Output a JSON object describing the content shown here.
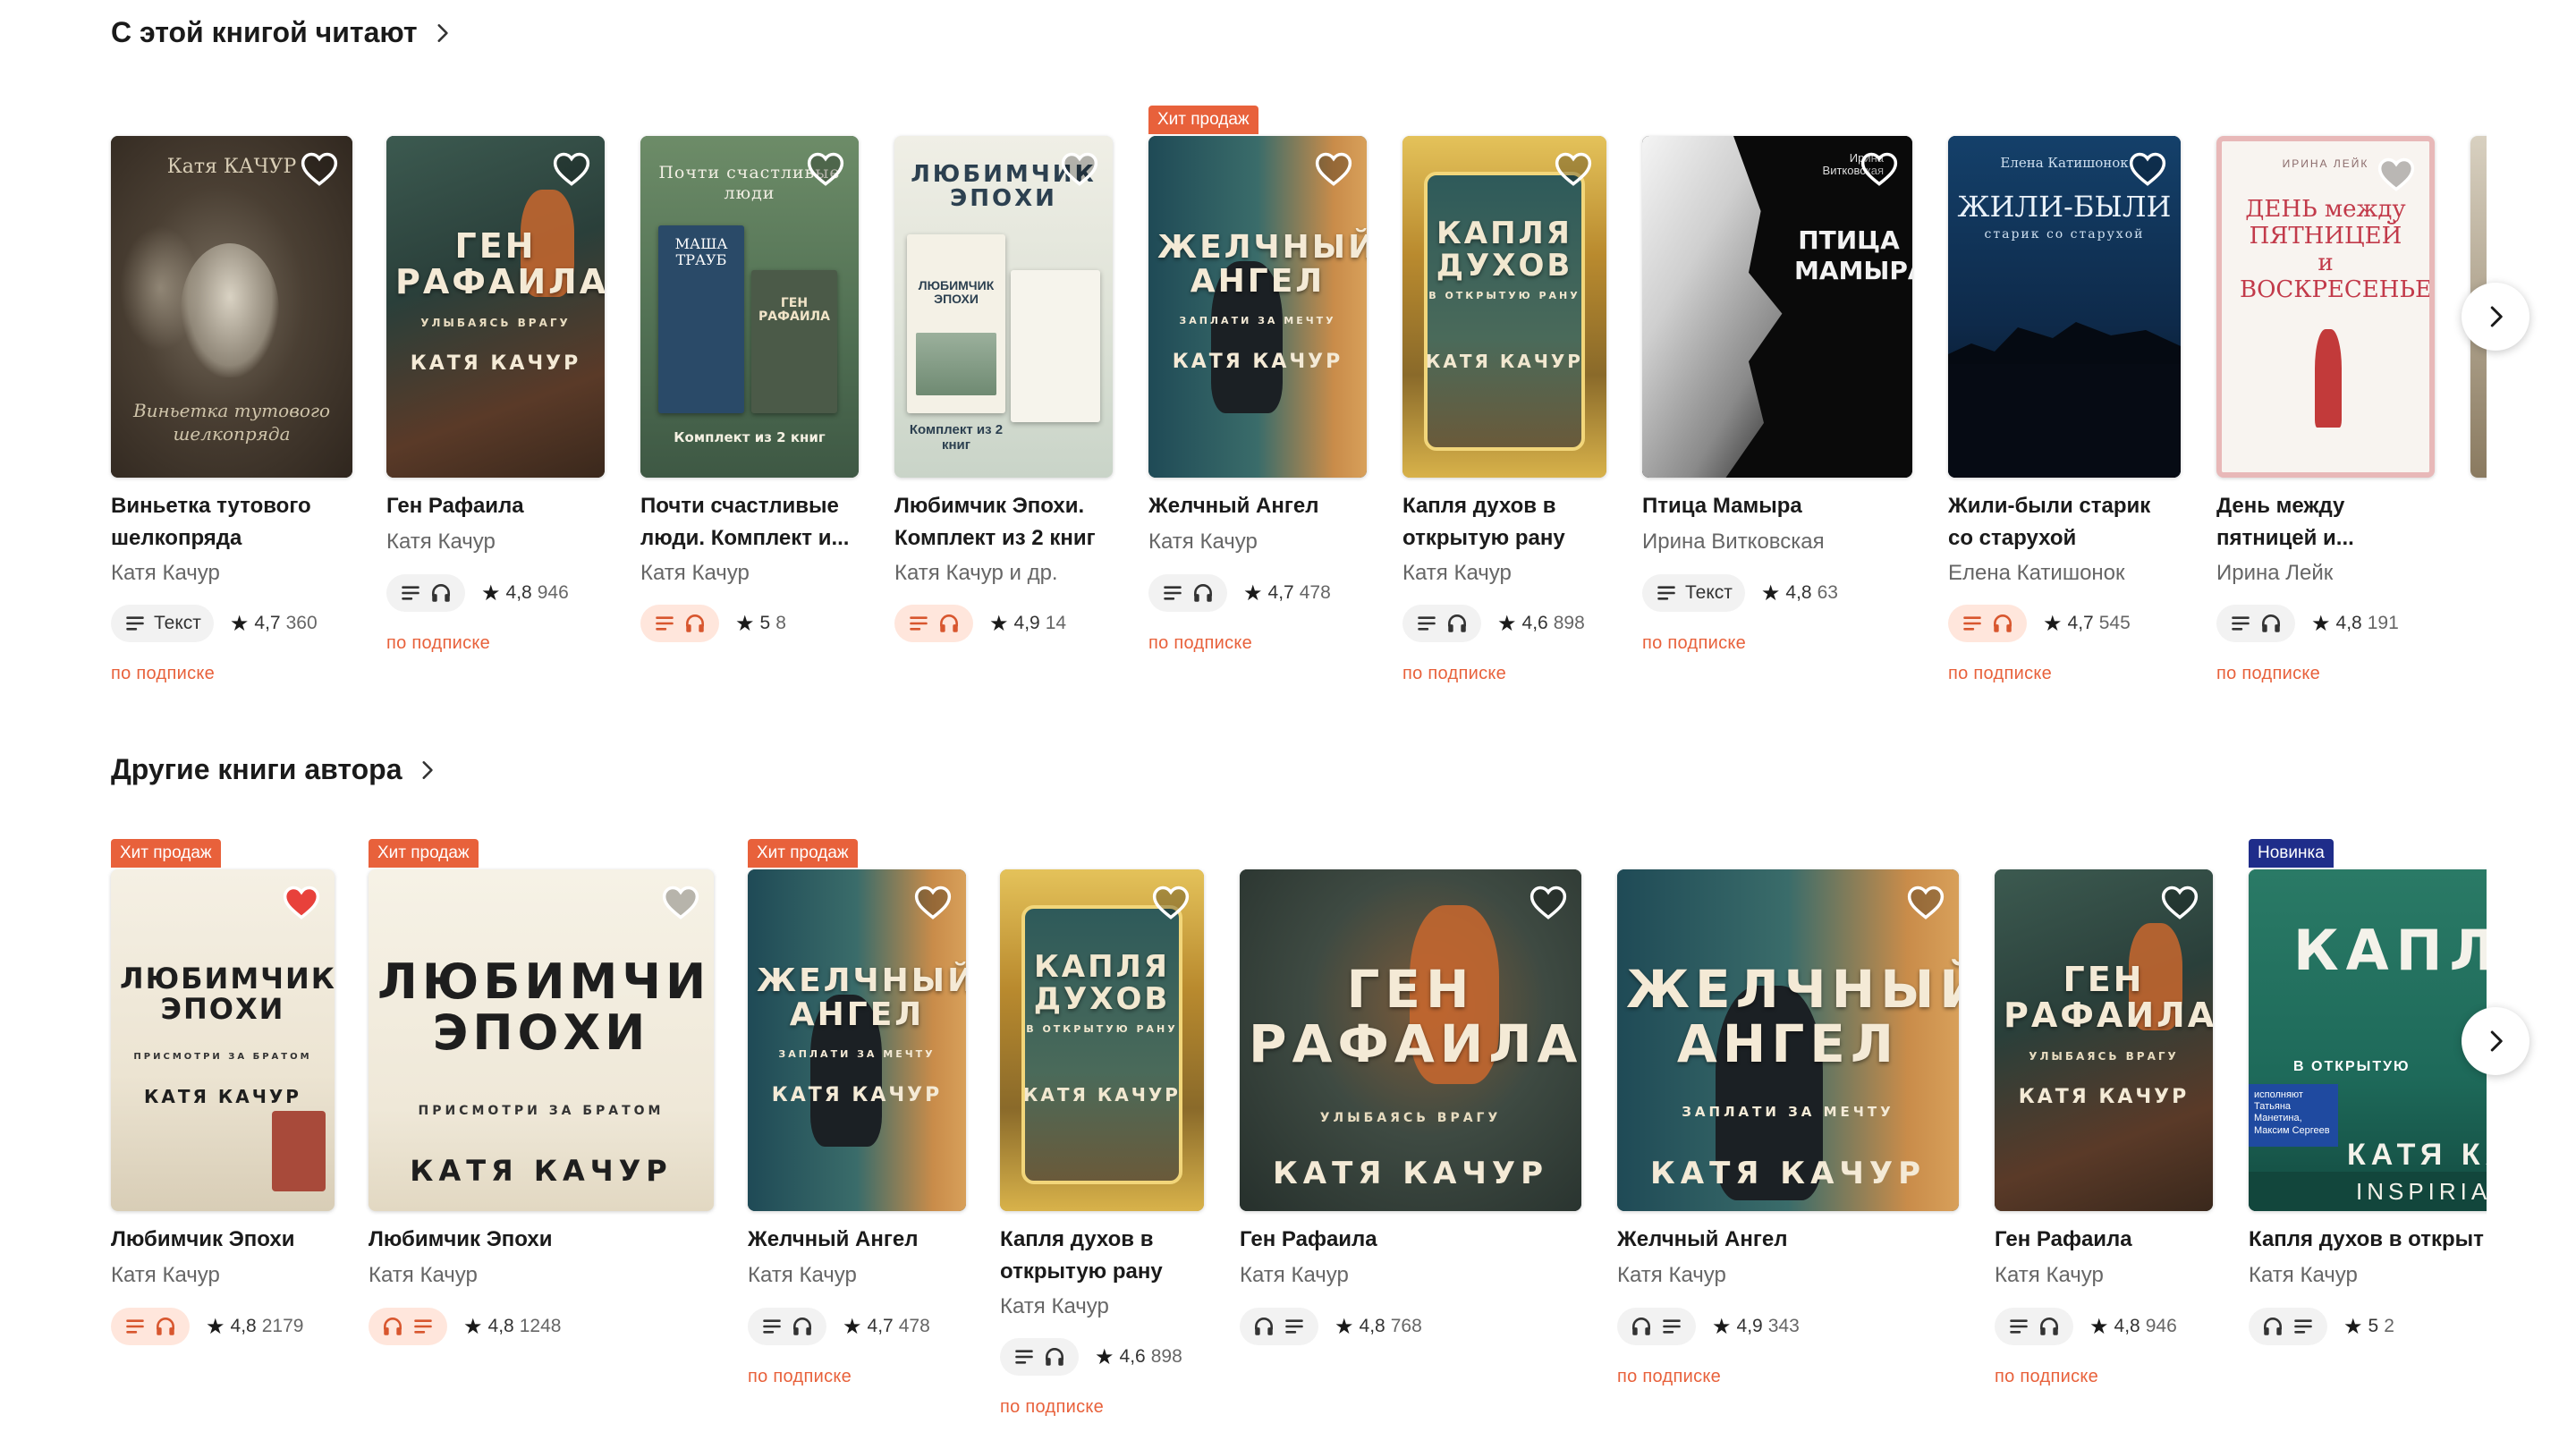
{
  "colors": {
    "accent": "#e8613b",
    "hit_badge": "#e8613b",
    "new_badge": "#1f2d8a"
  },
  "section1": {
    "title": "С этой книгой читают",
    "books": [
      {
        "title": "Виньетка тутового шелкопряда",
        "author": "Катя Качур",
        "format": "Текст",
        "rating": "4,7",
        "count": "360",
        "subscription": "по подписке",
        "cover_top": "Катя КАЧУР",
        "cover_bottom": "Виньетка тутового шелкопряда"
      },
      {
        "title": "Ген Рафаила",
        "author": "Катя Качур",
        "rating": "4,8",
        "count": "946",
        "subscription": "по подписке",
        "cover_main": "ГЕН РАФАИЛА",
        "cover_small": "УЛЫБАЯСЬ ВРАГУ",
        "cover_author": "КАТЯ КАЧУР"
      },
      {
        "title": "Почти счастливые люди. Комплект и...",
        "author": "Катя Качур",
        "rating": "5",
        "count": "8",
        "cover_top": "Почти счастливые люди",
        "cover_bottom": "Комплект из 2 книг",
        "cover_mini1": "МАША ТРАУБ",
        "cover_mini2": "ГЕН РАФАИЛА"
      },
      {
        "title": "Любимчик Эпохи. Комплект из 2 книг",
        "author": "Катя Качур и др.",
        "rating": "4,9",
        "count": "14",
        "cover_top": "ЛЮБИМЧИК ЭПОХИ",
        "cover_bottom": "Комплект из 2 книг"
      },
      {
        "title": "Желчный Ангел",
        "author": "Катя Качур",
        "badge": "Хит продаж",
        "rating": "4,7",
        "count": "478",
        "subscription": "по подписке",
        "cover_main": "ЖЕЛЧНЫЙ АНГЕЛ",
        "cover_small": "ЗАПЛАТИ ЗА МЕЧТУ",
        "cover_author": "КАТЯ КАЧУР"
      },
      {
        "title": "Капля духов в открытую рану",
        "author": "Катя Качур",
        "rating": "4,6",
        "count": "898",
        "subscription": "по подписке",
        "cover_main": "КАПЛЯ ДУХОВ",
        "cover_small": "В ОТКРЫТУЮ РАНУ",
        "cover_author": "КАТЯ КАЧУР"
      },
      {
        "title": "Птица Мамыра",
        "author": "Ирина Витковская",
        "format": "Текст",
        "rating": "4,8",
        "count": "63",
        "subscription": "по подписке",
        "cover_main": "ПТИЦА МАМЫРА",
        "cover_author": "Ирина Витковская"
      },
      {
        "title": "Жили-были старик со старухой",
        "author": "Елена Катишонок",
        "rating": "4,7",
        "count": "545",
        "subscription": "по подписке",
        "cover_author": "Елена Катишонок",
        "cover_main": "ЖИЛИ-БЫЛИ",
        "cover_small": "старик со старухой"
      },
      {
        "title": "День между пятницей и...",
        "author": "Ирина Лейк",
        "rating": "4,8",
        "count": "191",
        "subscription": "по подписке",
        "cover_author": "ИРИНА ЛЕЙК",
        "cover_main": "ДЕНЬ между ПЯТНИЦЕЙ и ВОСКРЕСЕНЬЕМ"
      }
    ]
  },
  "section2": {
    "title": "Другие книги автора",
    "books": [
      {
        "title": "Любимчик Эпохи",
        "author": "Катя Качур",
        "badge": "Хит продаж",
        "rating": "4,8",
        "count": "2179",
        "cover_main": "ЛЮБИМЧИК ЭПОХИ",
        "cover_small": "ПРИСМОТРИ ЗА БРАТОМ",
        "cover_author": "КАТЯ КАЧУР"
      },
      {
        "title": "Любимчик Эпохи",
        "author": "Катя Качур",
        "badge": "Хит продаж",
        "rating": "4,8",
        "count": "1248",
        "cover_main": "ЛЮБИМЧИК ЭПОХИ",
        "cover_small": "ПРИСМОТРИ ЗА БРАТОМ",
        "cover_author": "КАТЯ КАЧУР"
      },
      {
        "title": "Желчный Ангел",
        "author": "Катя Качур",
        "badge": "Хит продаж",
        "rating": "4,7",
        "count": "478",
        "subscription": "по подписке",
        "cover_main": "ЖЕЛЧНЫЙ АНГЕЛ",
        "cover_small": "ЗАПЛАТИ ЗА МЕЧТУ",
        "cover_author": "КАТЯ КАЧУР"
      },
      {
        "title": "Капля духов в открытую рану",
        "author": "Катя Качур",
        "rating": "4,6",
        "count": "898",
        "subscription": "по подписке",
        "cover_main": "КАПЛЯ ДУХОВ",
        "cover_small": "В ОТКРЫТУЮ РАНУ",
        "cover_author": "КАТЯ КАЧУР"
      },
      {
        "title": "Ген Рафаила",
        "author": "Катя Качур",
        "rating": "4,8",
        "count": "768",
        "cover_main": "ГЕН РАФАИЛА",
        "cover_small": "УЛЫБАЯСЬ ВРАГУ",
        "cover_author": "КАТЯ КАЧУР"
      },
      {
        "title": "Желчный Ангел",
        "author": "Катя Качур",
        "rating": "4,9",
        "count": "343",
        "subscription": "по подписке",
        "cover_main": "ЖЕЛЧНЫЙ АНГЕЛ",
        "cover_small": "ЗАПЛАТИ ЗА МЕЧТУ",
        "cover_author": "КАТЯ КАЧУР"
      },
      {
        "title": "Ген Рафаила",
        "author": "Катя Качур",
        "rating": "4,8",
        "count": "946",
        "subscription": "по подписке",
        "cover_main": "ГЕН РАФАИЛА",
        "cover_small": "УЛЫБАЯСЬ ВРАГУ",
        "cover_author": "КАТЯ КАЧУР"
      },
      {
        "title": "Капля духов в открыт",
        "author": "Катя Качур",
        "badge": "Новинка",
        "rating": "5",
        "count": "2",
        "cover_main": "КАПЛ ДУХО",
        "cover_small": "В ОТКРЫТУЮ",
        "cover_narrators": "исполняют Татьяна Манетина, Максим Сергеев",
        "cover_author": "КАТЯ КАЧ",
        "cover_brand": "INSPIRIA"
      }
    ]
  }
}
